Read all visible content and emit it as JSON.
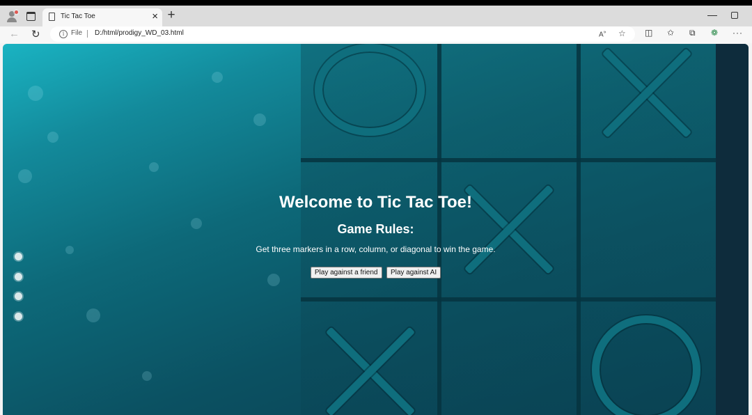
{
  "browser": {
    "tab_title": "Tic Tac Toe",
    "tab_close": "×",
    "new_tab": "+",
    "file_label": "File",
    "url": "D:/html/prodigy_WD_03.html",
    "more": "···"
  },
  "page": {
    "title": "Welcome to Tic Tac Toe!",
    "rules_heading": "Game Rules:",
    "rules_text": "Get three markers in a row, column, or diagonal to win the game.",
    "buttons": {
      "friend": "Play against a friend",
      "ai": "Play against AI"
    },
    "carousel_dots": 4
  },
  "colors": {
    "bg_top": "#1ab3c2",
    "bg_bottom": "#0a3c4e",
    "piece": "#0f6e7d",
    "text": "#ffffff"
  },
  "icons": [
    "profile-icon",
    "workspaces-icon",
    "page-icon",
    "close-icon",
    "plus-icon",
    "back-icon",
    "refresh-icon",
    "info-icon",
    "read-aloud-icon",
    "favorite-star-icon",
    "split-screen-icon",
    "favorites-icon",
    "collections-icon",
    "extensions-icon",
    "more-icon"
  ]
}
